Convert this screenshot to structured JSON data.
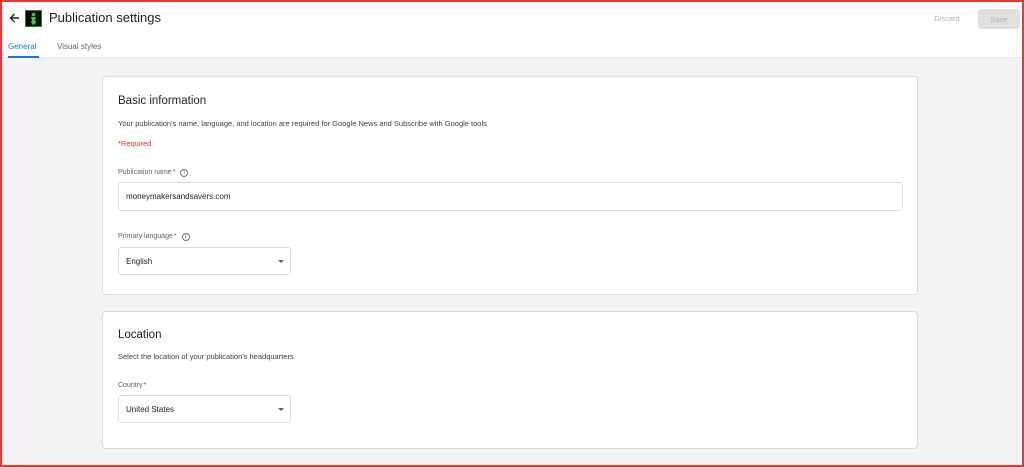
{
  "header": {
    "title": "Publication settings",
    "discard_label": "Discard",
    "save_label": "Save",
    "back_icon": "arrow-back-icon",
    "logo_icon": "publication-logo"
  },
  "tabs": [
    {
      "label": "General",
      "active": true
    },
    {
      "label": "Visual styles",
      "active": false
    }
  ],
  "basic_info": {
    "heading": "Basic information",
    "description": "Your publication's name, language, and location are required for Google News and Subscribe with Google tools",
    "required_note": "*Required",
    "publication_name": {
      "label": "Publication name",
      "required_mark": "*",
      "value": "moneymakersandsavers.com"
    },
    "primary_language": {
      "label": "Primary language",
      "required_mark": "*",
      "value": "English"
    }
  },
  "location": {
    "heading": "Location",
    "description": "Select the location of your publication's headquarters",
    "country": {
      "label": "Country",
      "required_mark": "*",
      "value": "United States"
    }
  },
  "colors": {
    "accent": "#1a73e8",
    "required": "#d93025",
    "frame": "#e53935"
  }
}
